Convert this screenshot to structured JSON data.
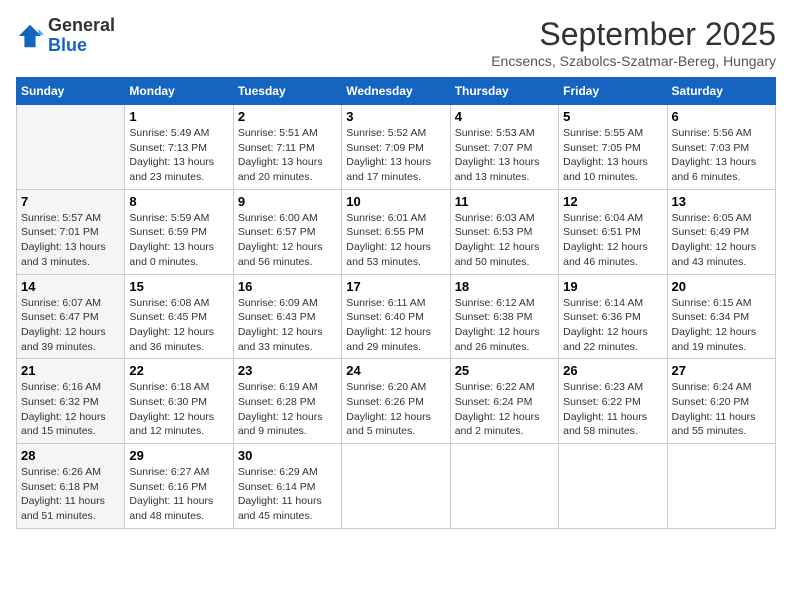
{
  "logo": {
    "general": "General",
    "blue": "Blue"
  },
  "header": {
    "title": "September 2025",
    "subtitle": "Encsencs, Szabolcs-Szatmar-Bereg, Hungary"
  },
  "columns": [
    "Sunday",
    "Monday",
    "Tuesday",
    "Wednesday",
    "Thursday",
    "Friday",
    "Saturday"
  ],
  "weeks": [
    [
      {
        "day": "",
        "sunrise": "",
        "sunset": "",
        "daylight": ""
      },
      {
        "day": "1",
        "sunrise": "Sunrise: 5:49 AM",
        "sunset": "Sunset: 7:13 PM",
        "daylight": "Daylight: 13 hours and 23 minutes."
      },
      {
        "day": "2",
        "sunrise": "Sunrise: 5:51 AM",
        "sunset": "Sunset: 7:11 PM",
        "daylight": "Daylight: 13 hours and 20 minutes."
      },
      {
        "day": "3",
        "sunrise": "Sunrise: 5:52 AM",
        "sunset": "Sunset: 7:09 PM",
        "daylight": "Daylight: 13 hours and 17 minutes."
      },
      {
        "day": "4",
        "sunrise": "Sunrise: 5:53 AM",
        "sunset": "Sunset: 7:07 PM",
        "daylight": "Daylight: 13 hours and 13 minutes."
      },
      {
        "day": "5",
        "sunrise": "Sunrise: 5:55 AM",
        "sunset": "Sunset: 7:05 PM",
        "daylight": "Daylight: 13 hours and 10 minutes."
      },
      {
        "day": "6",
        "sunrise": "Sunrise: 5:56 AM",
        "sunset": "Sunset: 7:03 PM",
        "daylight": "Daylight: 13 hours and 6 minutes."
      }
    ],
    [
      {
        "day": "7",
        "sunrise": "Sunrise: 5:57 AM",
        "sunset": "Sunset: 7:01 PM",
        "daylight": "Daylight: 13 hours and 3 minutes."
      },
      {
        "day": "8",
        "sunrise": "Sunrise: 5:59 AM",
        "sunset": "Sunset: 6:59 PM",
        "daylight": "Daylight: 13 hours and 0 minutes."
      },
      {
        "day": "9",
        "sunrise": "Sunrise: 6:00 AM",
        "sunset": "Sunset: 6:57 PM",
        "daylight": "Daylight: 12 hours and 56 minutes."
      },
      {
        "day": "10",
        "sunrise": "Sunrise: 6:01 AM",
        "sunset": "Sunset: 6:55 PM",
        "daylight": "Daylight: 12 hours and 53 minutes."
      },
      {
        "day": "11",
        "sunrise": "Sunrise: 6:03 AM",
        "sunset": "Sunset: 6:53 PM",
        "daylight": "Daylight: 12 hours and 50 minutes."
      },
      {
        "day": "12",
        "sunrise": "Sunrise: 6:04 AM",
        "sunset": "Sunset: 6:51 PM",
        "daylight": "Daylight: 12 hours and 46 minutes."
      },
      {
        "day": "13",
        "sunrise": "Sunrise: 6:05 AM",
        "sunset": "Sunset: 6:49 PM",
        "daylight": "Daylight: 12 hours and 43 minutes."
      }
    ],
    [
      {
        "day": "14",
        "sunrise": "Sunrise: 6:07 AM",
        "sunset": "Sunset: 6:47 PM",
        "daylight": "Daylight: 12 hours and 39 minutes."
      },
      {
        "day": "15",
        "sunrise": "Sunrise: 6:08 AM",
        "sunset": "Sunset: 6:45 PM",
        "daylight": "Daylight: 12 hours and 36 minutes."
      },
      {
        "day": "16",
        "sunrise": "Sunrise: 6:09 AM",
        "sunset": "Sunset: 6:43 PM",
        "daylight": "Daylight: 12 hours and 33 minutes."
      },
      {
        "day": "17",
        "sunrise": "Sunrise: 6:11 AM",
        "sunset": "Sunset: 6:40 PM",
        "daylight": "Daylight: 12 hours and 29 minutes."
      },
      {
        "day": "18",
        "sunrise": "Sunrise: 6:12 AM",
        "sunset": "Sunset: 6:38 PM",
        "daylight": "Daylight: 12 hours and 26 minutes."
      },
      {
        "day": "19",
        "sunrise": "Sunrise: 6:14 AM",
        "sunset": "Sunset: 6:36 PM",
        "daylight": "Daylight: 12 hours and 22 minutes."
      },
      {
        "day": "20",
        "sunrise": "Sunrise: 6:15 AM",
        "sunset": "Sunset: 6:34 PM",
        "daylight": "Daylight: 12 hours and 19 minutes."
      }
    ],
    [
      {
        "day": "21",
        "sunrise": "Sunrise: 6:16 AM",
        "sunset": "Sunset: 6:32 PM",
        "daylight": "Daylight: 12 hours and 15 minutes."
      },
      {
        "day": "22",
        "sunrise": "Sunrise: 6:18 AM",
        "sunset": "Sunset: 6:30 PM",
        "daylight": "Daylight: 12 hours and 12 minutes."
      },
      {
        "day": "23",
        "sunrise": "Sunrise: 6:19 AM",
        "sunset": "Sunset: 6:28 PM",
        "daylight": "Daylight: 12 hours and 9 minutes."
      },
      {
        "day": "24",
        "sunrise": "Sunrise: 6:20 AM",
        "sunset": "Sunset: 6:26 PM",
        "daylight": "Daylight: 12 hours and 5 minutes."
      },
      {
        "day": "25",
        "sunrise": "Sunrise: 6:22 AM",
        "sunset": "Sunset: 6:24 PM",
        "daylight": "Daylight: 12 hours and 2 minutes."
      },
      {
        "day": "26",
        "sunrise": "Sunrise: 6:23 AM",
        "sunset": "Sunset: 6:22 PM",
        "daylight": "Daylight: 11 hours and 58 minutes."
      },
      {
        "day": "27",
        "sunrise": "Sunrise: 6:24 AM",
        "sunset": "Sunset: 6:20 PM",
        "daylight": "Daylight: 11 hours and 55 minutes."
      }
    ],
    [
      {
        "day": "28",
        "sunrise": "Sunrise: 6:26 AM",
        "sunset": "Sunset: 6:18 PM",
        "daylight": "Daylight: 11 hours and 51 minutes."
      },
      {
        "day": "29",
        "sunrise": "Sunrise: 6:27 AM",
        "sunset": "Sunset: 6:16 PM",
        "daylight": "Daylight: 11 hours and 48 minutes."
      },
      {
        "day": "30",
        "sunrise": "Sunrise: 6:29 AM",
        "sunset": "Sunset: 6:14 PM",
        "daylight": "Daylight: 11 hours and 45 minutes."
      },
      {
        "day": "",
        "sunrise": "",
        "sunset": "",
        "daylight": ""
      },
      {
        "day": "",
        "sunrise": "",
        "sunset": "",
        "daylight": ""
      },
      {
        "day": "",
        "sunrise": "",
        "sunset": "",
        "daylight": ""
      },
      {
        "day": "",
        "sunrise": "",
        "sunset": "",
        "daylight": ""
      }
    ]
  ]
}
